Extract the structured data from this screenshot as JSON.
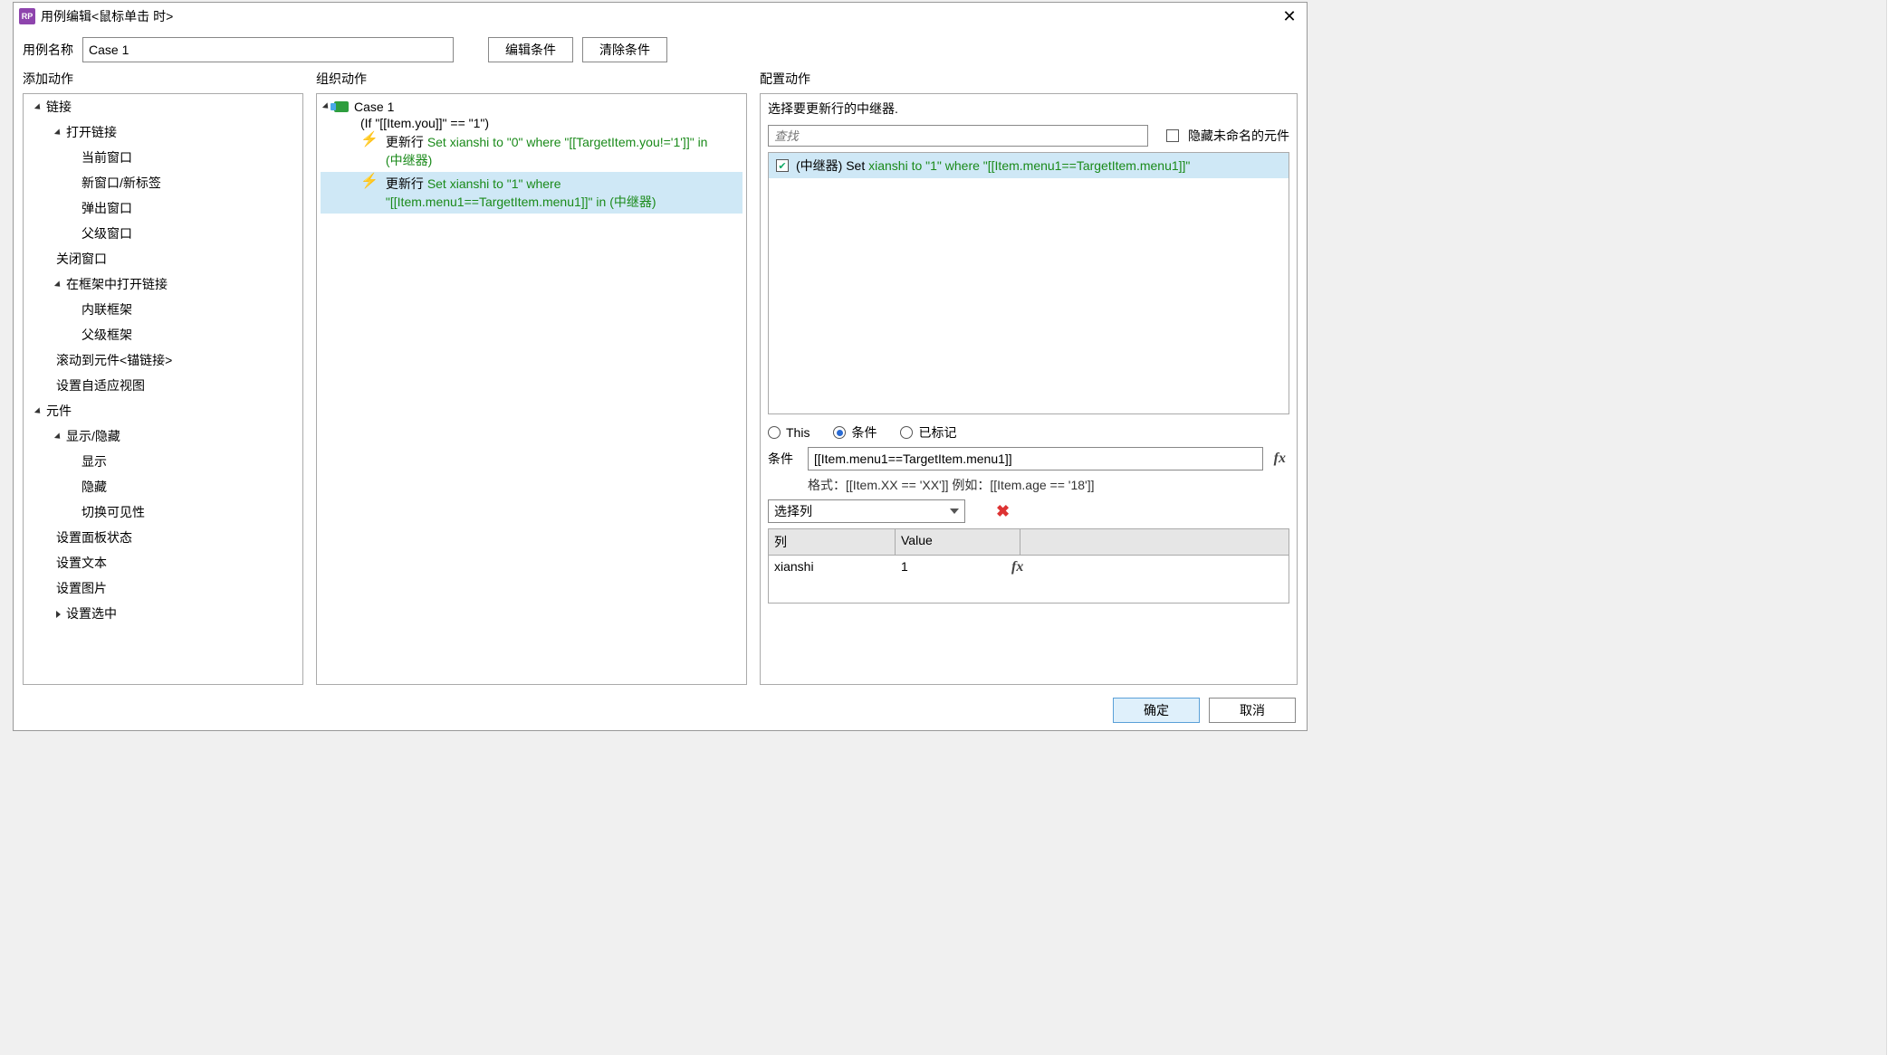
{
  "app_icon_label": "RP",
  "title": "用例编辑<鼠标单击 时>",
  "case_name_label": "用例名称",
  "case_name_value": "Case 1",
  "edit_conditions_btn": "编辑条件",
  "clear_conditions_btn": "清除条件",
  "col_headers": {
    "add": "添加动作",
    "org": "组织动作",
    "cfg": "配置动作"
  },
  "action_tree": {
    "group1": "链接",
    "open_link": "打开链接",
    "cur_window": "当前窗口",
    "new_window": "新窗口/新标签",
    "popup": "弹出窗口",
    "parent_window": "父级窗口",
    "close_window": "关闭窗口",
    "open_in_frame": "在框架中打开链接",
    "inline_frame": "内联框架",
    "parent_frame": "父级框架",
    "scroll_anchor": "滚动到元件<锚链接>",
    "adaptive_view": "设置自适应视图",
    "group2": "元件",
    "show_hide": "显示/隐藏",
    "show": "显示",
    "hide": "隐藏",
    "toggle_vis": "切换可见性",
    "panel_state": "设置面板状态",
    "set_text": "设置文本",
    "set_image": "设置图片",
    "set_selected": "设置选中"
  },
  "org": {
    "case_label": "Case 1",
    "condition": "(If \"[[Item.you]]\" == \"1\")",
    "row1_title": "更新行",
    "row1_detail_a": "Set xianshi to \"0\" where \"[[TargetItem.you!='1']]\" in",
    "row1_detail_b": "(中继器)",
    "row2_title": "更新行",
    "row2_detail_a": "Set xianshi to \"1\" where",
    "row2_detail_b": "\"[[Item.menu1==TargetItem.menu1]]\" in (中继器)"
  },
  "cfg": {
    "subtitle": "选择要更新行的中继器.",
    "search_placeholder": "查找",
    "hide_unnamed": "隐藏未命名的元件",
    "repeater_prefix": "(中继器) Set ",
    "repeater_green": "xianshi to \"1\" where \"[[Item.menu1==TargetItem.menu1]]\"",
    "radio_this": "This",
    "radio_cond": "条件",
    "radio_marked": "已标记",
    "cond_label": "条件",
    "cond_value": "[[Item.menu1==TargetItem.menu1]]",
    "fmt_hint": "格式：[[Item.XX == 'XX']] 例如：[[Item.age == '18']]",
    "select_col": "选择列",
    "tbl_col1": "列",
    "tbl_col2": "Value",
    "tbl_r1_c1": "xianshi",
    "tbl_r1_c2": "1"
  },
  "footer": {
    "ok": "确定",
    "cancel": "取消"
  }
}
